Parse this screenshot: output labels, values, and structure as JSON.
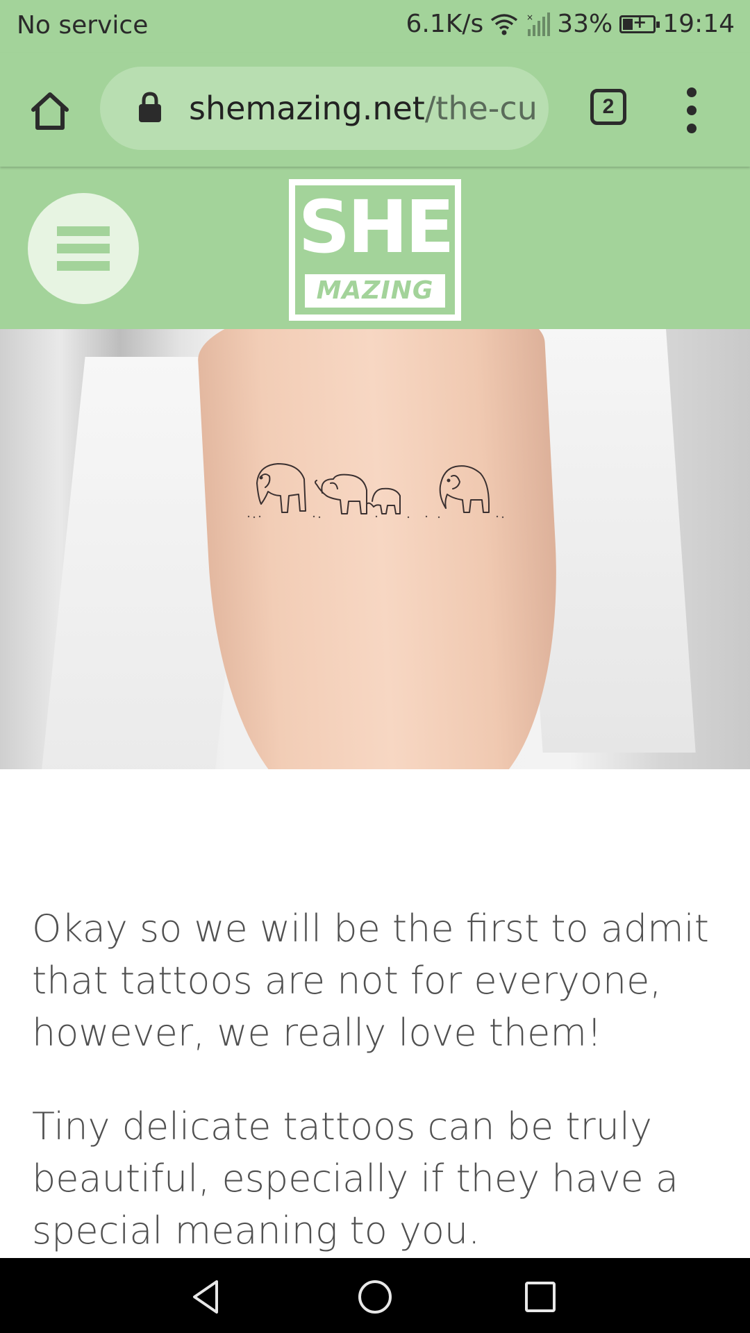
{
  "status_bar": {
    "carrier": "No service",
    "net_speed": "6.1K/s",
    "battery": "33%",
    "time": "19:14",
    "icons": [
      "wifi-icon",
      "signal-icon",
      "battery-charging-icon"
    ]
  },
  "browser": {
    "url_domain": "shemazing.net",
    "url_path": "/the-cute",
    "tab_count": "2",
    "icons": [
      "home-icon",
      "lock-icon",
      "tabs-icon",
      "more-vert-icon"
    ]
  },
  "site": {
    "logo_top": "SHE",
    "logo_bottom": "MAZING",
    "menu_icon": "hamburger-menu-icon",
    "brand_color": "#a3d39a"
  },
  "hero": {
    "alt": "elephant family tattoo on forearm"
  },
  "article": {
    "paragraphs": [
      "Okay so we will be the first to admit that tattoos are not for everyone, however, we really love them!",
      "Tiny delicate tattoos can be truly beautiful, especially if they have a special meaning to you."
    ]
  },
  "nav_bar": {
    "icons": [
      "back-icon",
      "home-circle-icon",
      "recents-icon"
    ]
  }
}
